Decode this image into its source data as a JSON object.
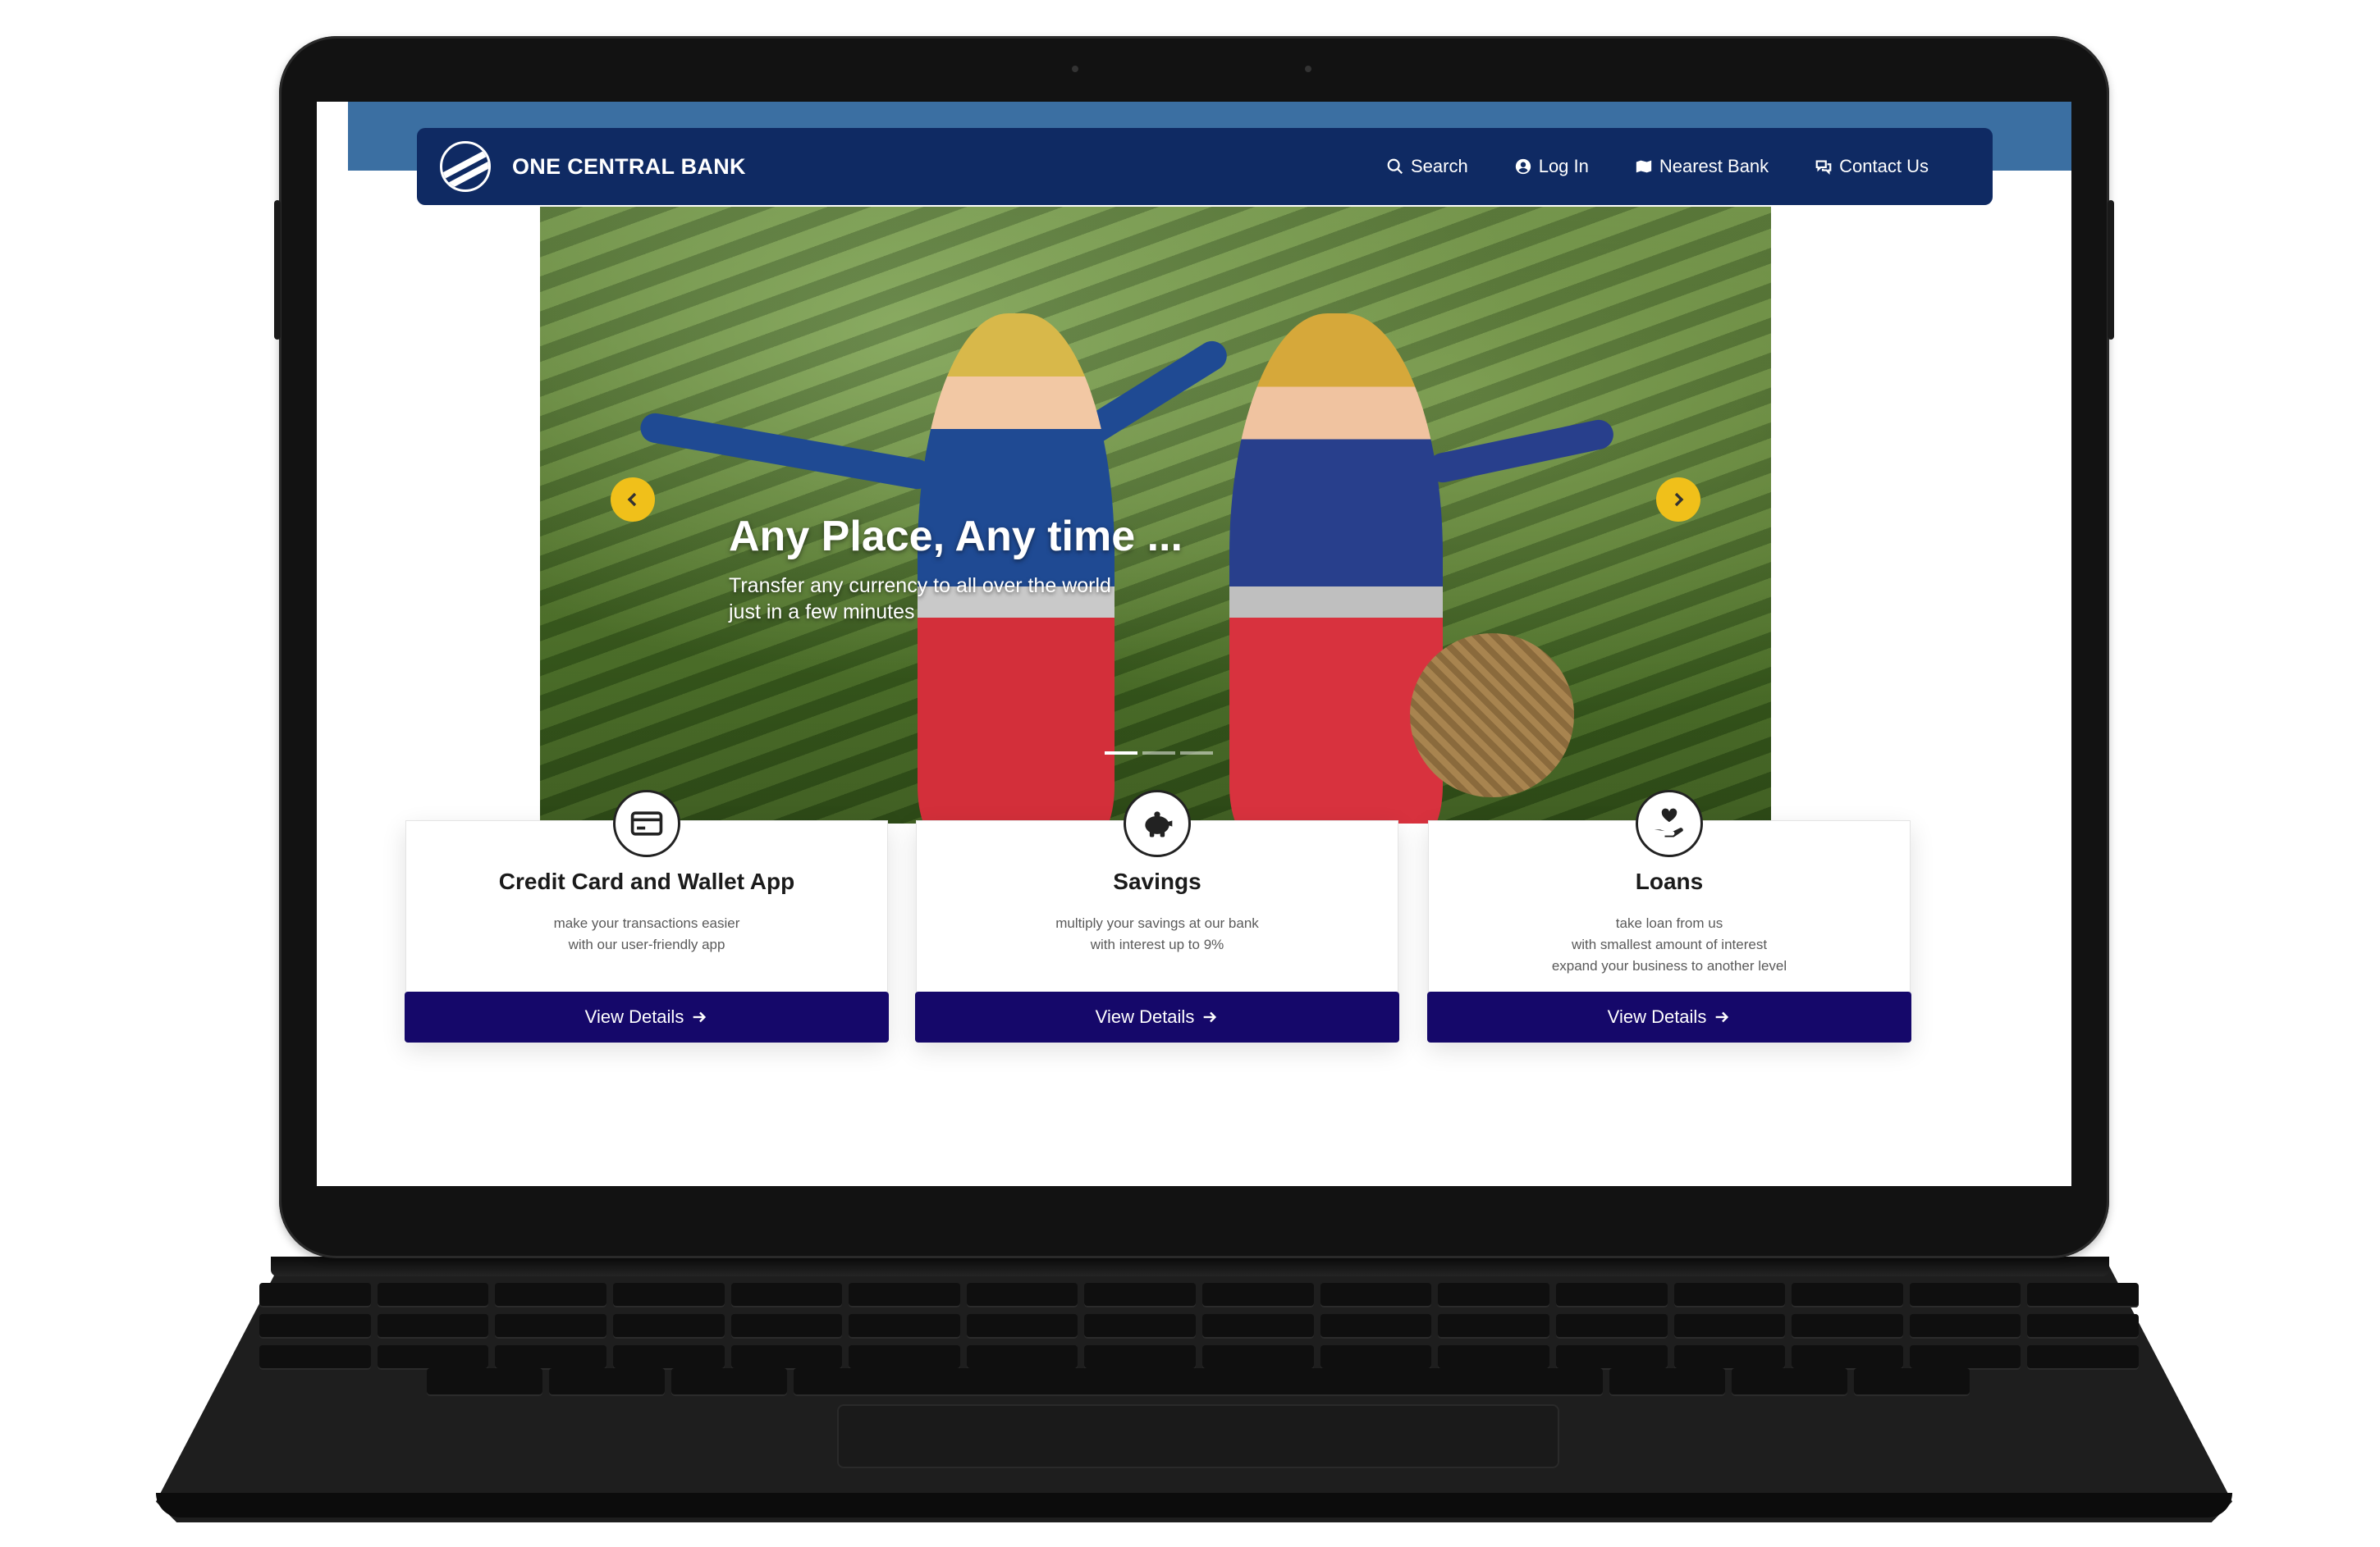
{
  "brand": {
    "name": "ONE CENTRAL BANK"
  },
  "nav": {
    "items": [
      {
        "label": "Search",
        "icon": "search-icon"
      },
      {
        "label": "Log In",
        "icon": "user-circle-icon"
      },
      {
        "label": "Nearest Bank",
        "icon": "map-icon"
      },
      {
        "label": "Contact Us",
        "icon": "chat-icon"
      }
    ]
  },
  "hero": {
    "title": "Any Place, Any time ...",
    "subtitle": "Transfer any currency to all over the world\njust in a few minutes",
    "slide_count": 3,
    "active_slide": 1
  },
  "services": [
    {
      "title": "Credit Card and Wallet App",
      "text": "make your transactions easier\nwith our user-friendly app",
      "button": "View Details",
      "icon": "credit-card-icon"
    },
    {
      "title": "Savings",
      "text": "multiply your savings at our bank\nwith interest up to 9%",
      "button": "View Details",
      "icon": "piggy-bank-icon"
    },
    {
      "title": "Loans",
      "text": "take loan from us\nwith smallest amount of interest\nexpand your business to another level",
      "button": "View Details",
      "icon": "hand-heart-icon"
    }
  ],
  "colors": {
    "top_band": "#3b6fa2",
    "navbar": "#0f2a63",
    "button": "#15086a",
    "carousel_arrow": "#f0c01a"
  }
}
